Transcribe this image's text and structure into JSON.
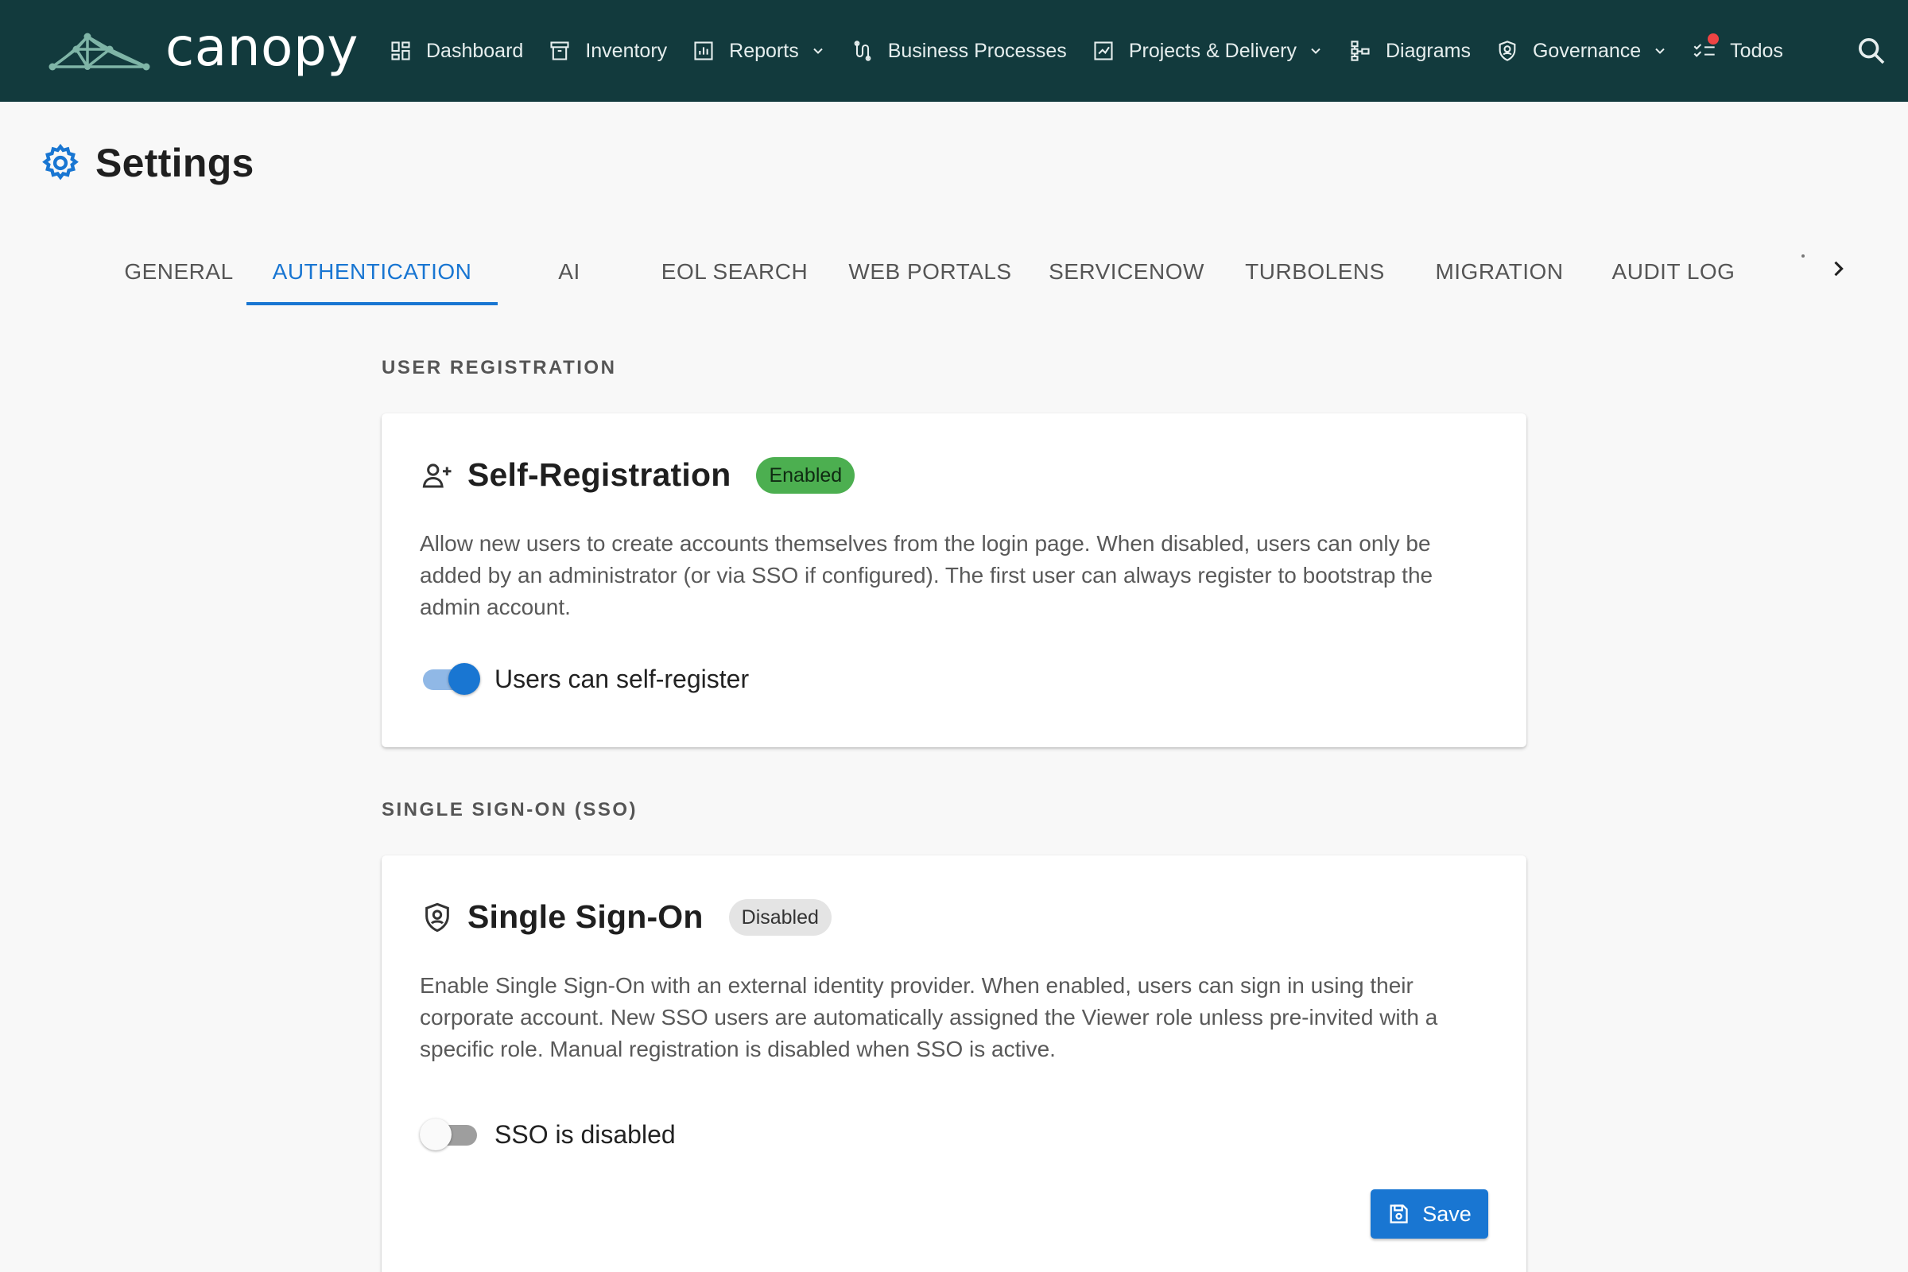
{
  "app": {
    "name": "canopy"
  },
  "nav": {
    "items": [
      {
        "label": "Dashboard",
        "icon": "dashboard-icon",
        "dropdown": false
      },
      {
        "label": "Inventory",
        "icon": "inventory-icon",
        "dropdown": false
      },
      {
        "label": "Reports",
        "icon": "reports-icon",
        "dropdown": true
      },
      {
        "label": "Business Processes",
        "icon": "business-processes-icon",
        "dropdown": false
      },
      {
        "label": "Projects & Delivery",
        "icon": "projects-icon",
        "dropdown": true
      },
      {
        "label": "Diagrams",
        "icon": "diagrams-icon",
        "dropdown": false
      },
      {
        "label": "Governance",
        "icon": "governance-icon",
        "dropdown": true
      },
      {
        "label": "Todos",
        "icon": "todos-icon",
        "dropdown": false,
        "has_notification": true
      }
    ],
    "search_icon": "search-icon"
  },
  "page": {
    "title": "Settings",
    "icon": "gear-icon"
  },
  "tabs": {
    "items": [
      "GENERAL",
      "AUTHENTICATION",
      "AI",
      "EOL SEARCH",
      "WEB PORTALS",
      "SERVICENOW",
      "TURBOLENS",
      "MIGRATION",
      "AUDIT LOG"
    ],
    "active": "AUTHENTICATION",
    "next_icon": "chevron-right-icon"
  },
  "sections": {
    "user_registration": {
      "label": "USER REGISTRATION",
      "card": {
        "title": "Self-Registration",
        "icon": "person-add-icon",
        "badge": "Enabled",
        "description": "Allow new users to create accounts themselves from the login page. When disabled, users can only be added by an administrator (or via SSO if configured). The first user can always register to bootstrap the admin account.",
        "toggle": {
          "label": "Users can self-register",
          "checked": true
        }
      }
    },
    "sso": {
      "label": "SINGLE SIGN-ON (SSO)",
      "card": {
        "title": "Single Sign-On",
        "icon": "shield-icon",
        "badge": "Disabled",
        "description": "Enable Single Sign-On with an external identity provider. When enabled, users can sign in using their corporate account. New SSO users are automatically assigned the Viewer role unless pre-invited with a specific role. Manual registration is disabled when SSO is active.",
        "toggle": {
          "label": "SSO is disabled",
          "checked": false
        },
        "save_label": "Save"
      }
    }
  },
  "colors": {
    "topbar": "#123a3d",
    "accent": "#1976d2",
    "enabled_badge": "#4caf50",
    "disabled_badge": "#e4e4e4",
    "notification": "#ef4444"
  }
}
